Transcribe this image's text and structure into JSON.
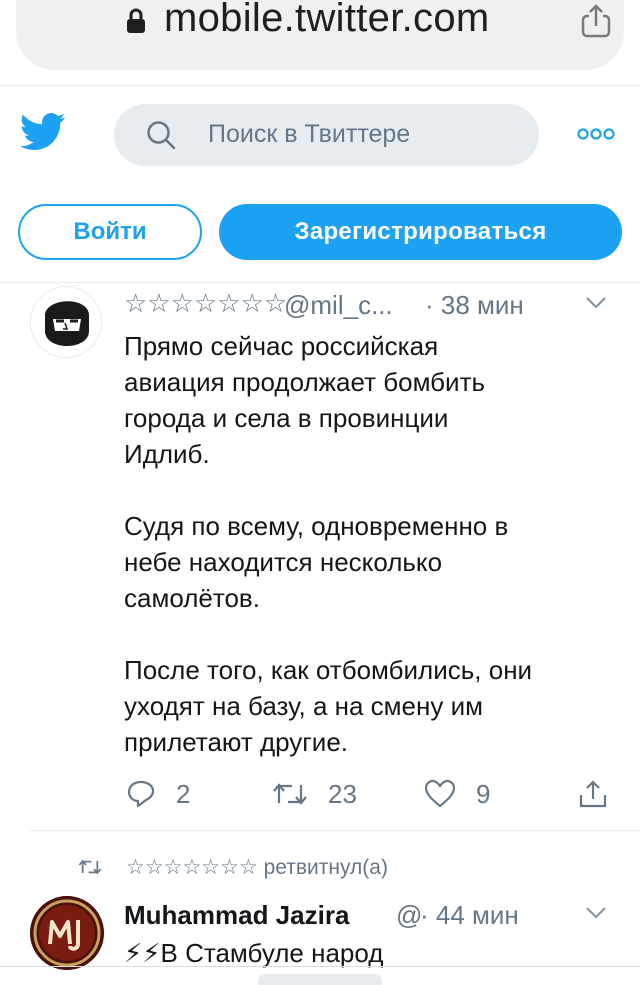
{
  "browser": {
    "url": "mobile.twitter.com"
  },
  "header": {
    "search_placeholder": "Поиск в Твиттере"
  },
  "auth": {
    "login_label": "Войти",
    "signup_label": "Зарегистрироваться"
  },
  "tweets": [
    {
      "name": "☆☆☆☆☆☆☆",
      "handle": "@mil_c...",
      "time": "· 38 мин",
      "text": "Прямо сейчас российская\nавиация продолжает бомбить\nгорода и села в провинции\nИдлиб.\n\nСудя по всему, одновременно в\nнебе находится несколько\nсамолётов.\n\nПосле того, как отбомбились, они\nуходят на базу, а на смену им\nприлетают другие.",
      "replies": "2",
      "retweets": "23",
      "likes": "9"
    },
    {
      "retweeted_by": "☆☆☆☆☆☆☆ ретвитнул(а)",
      "name": "Muhammad Jazira",
      "handle": "@",
      "time": "· 44 мин",
      "text": "⚡⚡В Стамбуле народ"
    }
  ],
  "colors": {
    "brand": "#1da1f2",
    "secondary_text": "#657786",
    "primary_text": "#14171a"
  }
}
